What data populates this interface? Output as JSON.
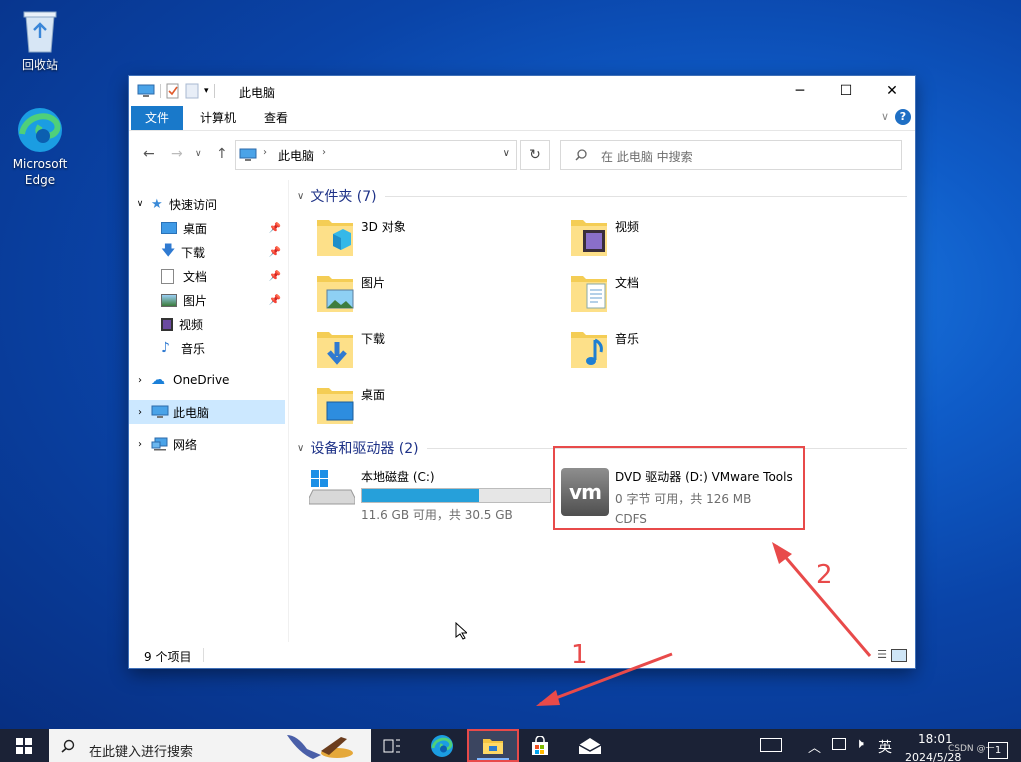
{
  "desktop": {
    "icons": [
      {
        "label": "回收站"
      },
      {
        "label": "Microsoft Edge"
      }
    ]
  },
  "window": {
    "title": "此电脑",
    "ribbon_tabs": [
      "文件",
      "计算机",
      "查看"
    ],
    "address": {
      "path": "此电脑"
    },
    "search_placeholder": "在 此电脑 中搜索",
    "nav": {
      "quick_access": "快速访问",
      "quick_items": [
        "桌面",
        "下载",
        "文档",
        "图片",
        "视频",
        "音乐"
      ],
      "onedrive": "OneDrive",
      "this_pc": "此电脑",
      "network": "网络"
    },
    "folders_group": "文件夹 (7)",
    "folders": [
      "3D 对象",
      "视频",
      "图片",
      "文档",
      "下载",
      "音乐",
      "桌面"
    ],
    "drives_group": "设备和驱动器 (2)",
    "drives": [
      {
        "name": "本地磁盘 (C:)",
        "info": "11.6 GB 可用，共 30.5 GB",
        "used_fraction": 0.62
      },
      {
        "name": "DVD 驱动器 (D:) VMware Tools",
        "info": "0 字节 可用，共 126 MB",
        "fs": "CDFS"
      }
    ],
    "status": "9 个项目"
  },
  "annotations": {
    "one": "1",
    "two": "2",
    "color": "#e84a4a"
  },
  "taskbar": {
    "search_placeholder": "在此键入进行搜索",
    "ime": "英",
    "time": "18:01",
    "date": "2024/5/28",
    "watermark": "CSDN @一",
    "notification_count": "1"
  }
}
